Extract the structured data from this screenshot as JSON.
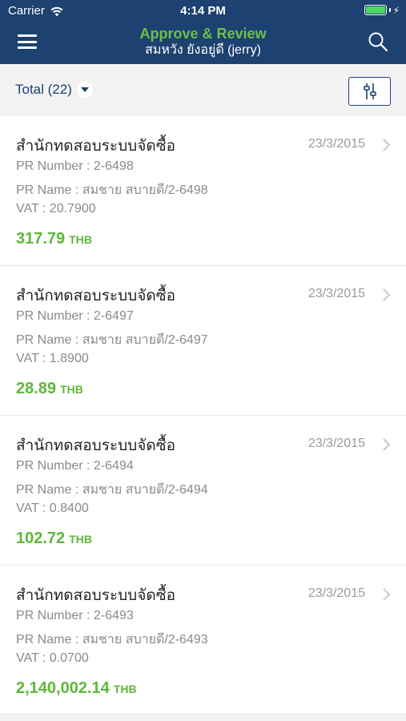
{
  "status_bar": {
    "carrier": "Carrier",
    "time": "4:14 PM",
    "battery_level": 1.0
  },
  "nav": {
    "title": "Approve & Review",
    "subtitle": "สมหวัง ยังอยู่ดี (jerry)",
    "menu_icon": "hamburger-menu-icon",
    "search_icon": "search-icon"
  },
  "filter": {
    "total_label": "Total (22)",
    "filter_icon": "sliders-icon"
  },
  "colors": {
    "header_bg": "#1d4170",
    "accent_green": "#5db83a",
    "title_green": "#6cc04a"
  },
  "items": [
    {
      "title": "สำนักทดสอบระบบจัดซื้อ",
      "date": "23/3/2015",
      "pr_number_label": "PR Number :",
      "pr_number": "2-6498",
      "pr_name_label": "PR Name :",
      "pr_name": "สมชาย สบายดี/2-6498",
      "vat_label": "VAT :",
      "vat": "20.7900",
      "amount": "317.79",
      "currency": "THB"
    },
    {
      "title": "สำนักทดสอบระบบจัดซื้อ",
      "date": "23/3/2015",
      "pr_number_label": "PR Number :",
      "pr_number": "2-6497",
      "pr_name_label": "PR Name :",
      "pr_name": "สมชาย สบายดี/2-6497",
      "vat_label": "VAT :",
      "vat": "1.8900",
      "amount": "28.89",
      "currency": "THB"
    },
    {
      "title": "สำนักทดสอบระบบจัดซื้อ",
      "date": "23/3/2015",
      "pr_number_label": "PR Number :",
      "pr_number": "2-6494",
      "pr_name_label": "PR Name :",
      "pr_name": "สมชาย สบายดี/2-6494",
      "vat_label": "VAT :",
      "vat": "0.8400",
      "amount": "102.72",
      "currency": "THB"
    },
    {
      "title": "สำนักทดสอบระบบจัดซื้อ",
      "date": "23/3/2015",
      "pr_number_label": "PR Number :",
      "pr_number": "2-6493",
      "pr_name_label": "PR Name :",
      "pr_name": "สมชาย สบายดี/2-6493",
      "vat_label": "VAT :",
      "vat": "0.0700",
      "amount": "2,140,002.14",
      "currency": "THB"
    }
  ]
}
